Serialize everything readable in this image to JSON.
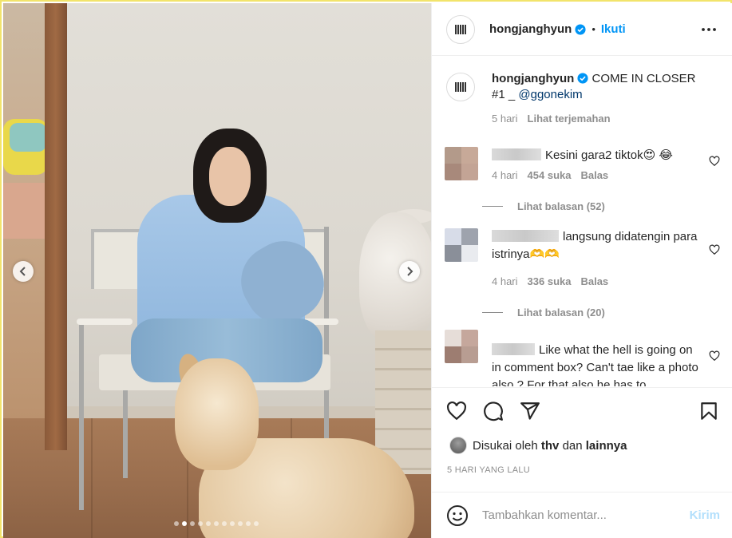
{
  "post": {
    "username": "hongjanghyun",
    "follow_label": "Ikuti",
    "separator": "•",
    "caption_text": "COME IN CLOSER #1 _",
    "caption_mention": "@ggonekim",
    "caption_time": "5 hari",
    "translate_label": "Lihat terjemahan",
    "carousel": {
      "slide_count": 11,
      "active_index": 1
    }
  },
  "comments": [
    {
      "text": "Kesini gara2 tiktok😍 😂",
      "time": "4 hari",
      "likes": "454 suka",
      "reply_label": "Balas",
      "view_replies": "Lihat balasan (52)",
      "avatar_colors": [
        "#b39a8a",
        "#c7a998",
        "#a8897b",
        "#c3a495"
      ]
    },
    {
      "text": "langsung didatengin para istrinya🫶🫶",
      "time": "4 hari",
      "likes": "336 suka",
      "reply_label": "Balas",
      "view_replies": "Lihat balasan (20)",
      "avatar_colors": [
        "#d7dce8",
        "#9ea3ad",
        "#8a8f99",
        "#e9ebef"
      ]
    },
    {
      "text": "Like what the hell is going on in comment box? Can't tae like a photo also ? For that also he has to",
      "avatar_colors": [
        "#e6ddd8",
        "#c5a79c",
        "#9d7d71",
        "#b89d92"
      ]
    }
  ],
  "actions": {
    "liked_by_prefix": "Disukai oleh",
    "liked_by_user": "thv",
    "liked_by_join": "dan",
    "liked_by_others": "lainnya",
    "timestamp": "5 HARI YANG LALU"
  },
  "add_comment": {
    "placeholder": "Tambahkan komentar...",
    "post_label": "Kirim"
  },
  "colors": {
    "accent": "#0095f6",
    "verified": "#0095f6",
    "mention": "#00376b",
    "muted": "#8e8e8e",
    "post_disabled": "#b2dffc",
    "frame": "#f2e46b"
  },
  "icons": {
    "header_more": "more-horizontal-icon",
    "verified": "verified-badge-icon",
    "like": "heart-icon",
    "comment": "comment-icon",
    "share": "paper-plane-icon",
    "save": "bookmark-icon",
    "emoji": "smiley-icon",
    "prev": "chevron-left-icon",
    "next": "chevron-right-icon"
  }
}
